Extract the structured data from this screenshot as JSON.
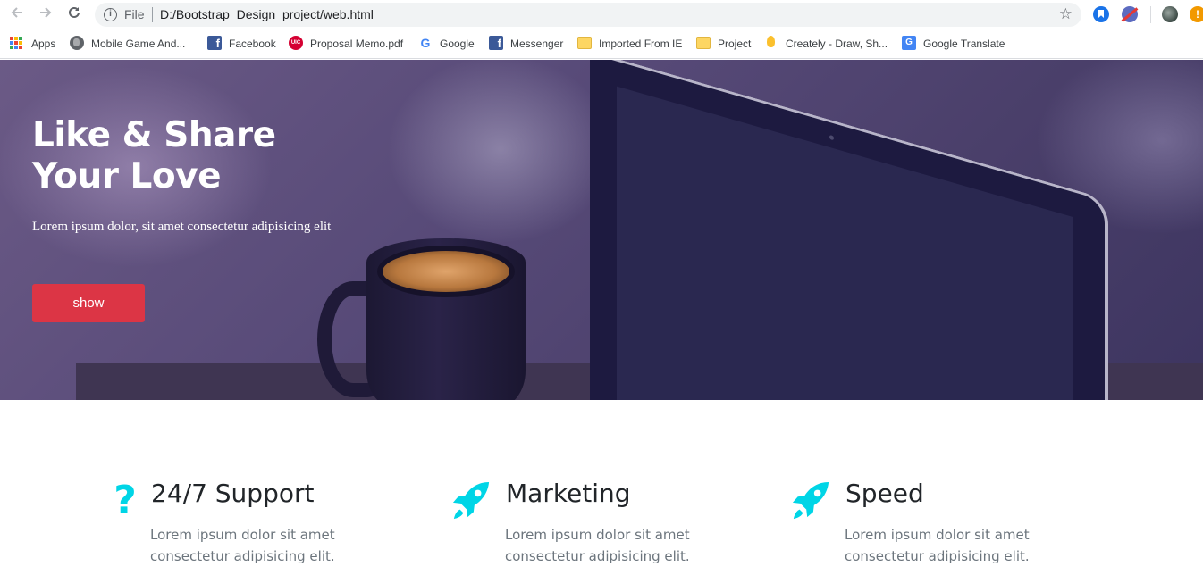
{
  "browser": {
    "back_icon": "arrow-left-icon",
    "forward_icon": "arrow-right-icon",
    "reload_icon": "reload-icon",
    "scheme_label": "File",
    "url": "D:/Bootstrap_Design_project/web.html",
    "star_icon": "star-icon",
    "extension_alert": "!"
  },
  "bookmarks": [
    {
      "label": "Apps",
      "icon": "apps-grid-icon"
    },
    {
      "label": "Mobile Game And...",
      "icon": "globe-icon"
    },
    {
      "label": "Facebook",
      "icon": "facebook-icon"
    },
    {
      "label": "Proposal Memo.pdf",
      "icon": "uic-icon"
    },
    {
      "label": "Google",
      "icon": "google-icon"
    },
    {
      "label": "Messenger",
      "icon": "facebook-icon"
    },
    {
      "label": "Imported From IE",
      "icon": "folder-icon"
    },
    {
      "label": "Project",
      "icon": "folder-icon"
    },
    {
      "label": "Creately - Draw, Sh...",
      "icon": "lightbulb-icon"
    },
    {
      "label": "Google Translate",
      "icon": "translate-icon"
    }
  ],
  "hero": {
    "title": "Like & Share Your Love",
    "text": "Lorem ipsum dolor, sit amet consectetur adipisicing elit",
    "button_label": "show"
  },
  "features": [
    {
      "title": "24/7 Support",
      "text": "Lorem ipsum dolor sit amet consectetur adipisicing elit.",
      "icon": "question-icon"
    },
    {
      "title": "Marketing",
      "text": "Lorem ipsum dolor sit amet consectetur adipisicing elit.",
      "icon": "rocket-icon"
    },
    {
      "title": "Speed",
      "text": "Lorem ipsum dolor sit amet consectetur adipisicing elit.",
      "icon": "rocket-icon"
    }
  ],
  "colors": {
    "accent": "#00d5e6",
    "button": "#dc3545",
    "heading": "#212529",
    "muted_text": "#6c757d"
  }
}
